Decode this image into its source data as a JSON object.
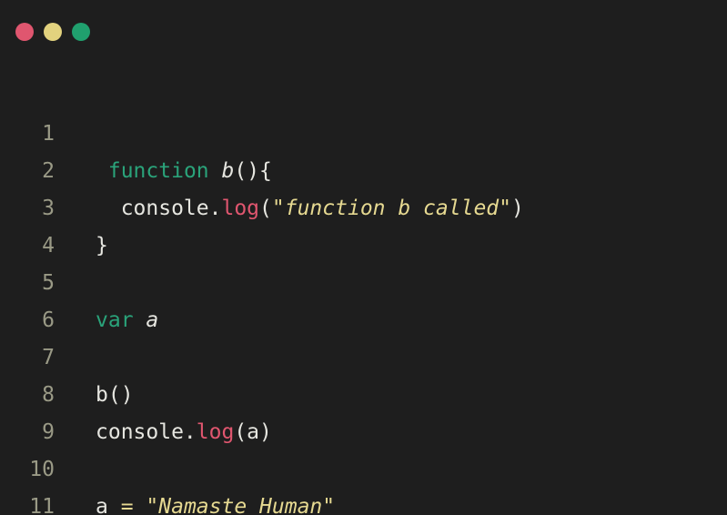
{
  "window": {
    "traffic_lights": [
      {
        "name": "close",
        "color": "#e0566f"
      },
      {
        "name": "minimize",
        "color": "#e2d27e"
      },
      {
        "name": "maximize",
        "color": "#20a06e"
      }
    ]
  },
  "editor": {
    "lines": [
      {
        "number": "1",
        "tokens": [
          " ",
          "function",
          " ",
          "b",
          "(){"
        ]
      },
      {
        "number": "2",
        "tokens": [
          "  console.",
          "log",
          "(",
          "\"function b called\"",
          ")"
        ]
      },
      {
        "number": "3",
        "tokens": [
          "}"
        ]
      },
      {
        "number": "4",
        "tokens": []
      },
      {
        "number": "5",
        "tokens": [
          "var",
          " ",
          "a"
        ]
      },
      {
        "number": "6",
        "tokens": []
      },
      {
        "number": "7",
        "tokens": [
          "b()"
        ]
      },
      {
        "number": "8",
        "tokens": [
          "console.",
          "log",
          "(a)"
        ]
      },
      {
        "number": "9",
        "tokens": []
      },
      {
        "number": "10",
        "tokens": [
          "a ",
          "=",
          " ",
          "\"Namaste Human\""
        ]
      },
      {
        "number": "11",
        "tokens": []
      }
    ]
  }
}
